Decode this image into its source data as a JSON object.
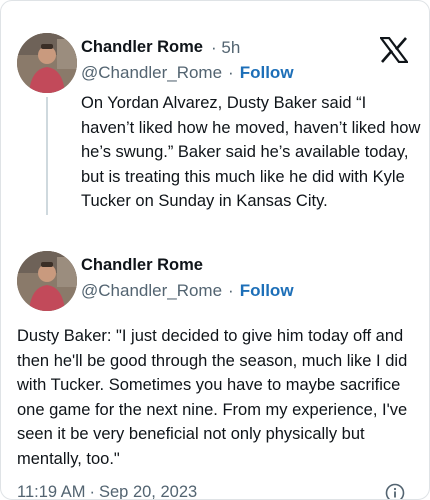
{
  "tweet1": {
    "author_name": "Chandler Rome",
    "separator": "·",
    "time_ago": "5h",
    "handle": "@Chandler_Rome",
    "follow_label": "Follow",
    "text": "On Yordan Alvarez, Dusty Baker said “I haven’t liked how he moved, haven’t liked how he’s swung.” Baker said he’s available today, but is treating this much like he did with Kyle Tucker on Sunday in Kansas City."
  },
  "tweet2": {
    "author_name": "Chandler Rome",
    "handle": "@Chandler_Rome",
    "separator": "·",
    "follow_label": "Follow",
    "text": "Dusty Baker: \"I just decided to give him today off and then he'll be good through the season, much like I did with Tucker. Sometimes you have to maybe sacrifice one game for the next nine. From my experience, I've seen it be very beneficial not only physically but mentally, too.\"",
    "time": "11:19 AM",
    "separator_footer": "·",
    "date": "Sep 20, 2023"
  },
  "icons": {
    "brand": "x-logo-icon",
    "info": "info-icon"
  },
  "colors": {
    "follow": "#1d6fb8",
    "muted": "#536471",
    "text": "#0f1419",
    "thread_line": "#cfd9de"
  }
}
